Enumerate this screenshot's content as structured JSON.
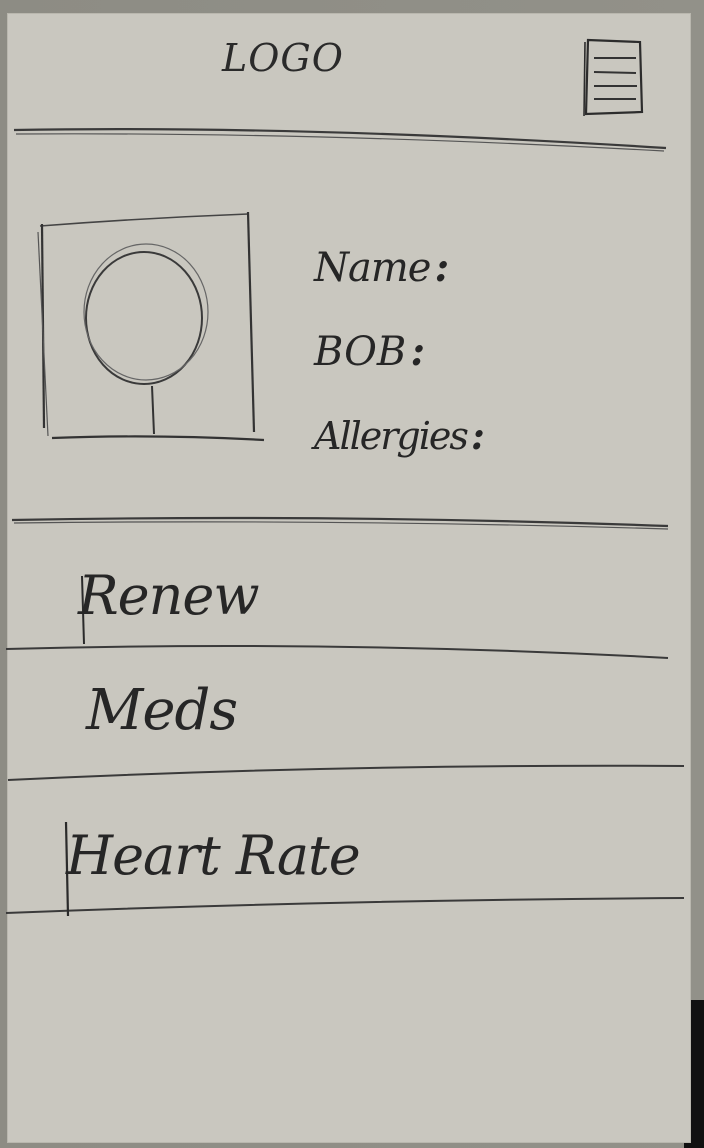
{
  "header": {
    "logo_text": "LOGO",
    "menu_icon": "hamburger-menu-icon"
  },
  "profile": {
    "avatar_icon": "user-avatar-placeholder-icon",
    "fields": [
      {
        "label": "Name",
        "suffix": ":"
      },
      {
        "label": "BOB",
        "suffix": ":"
      },
      {
        "label": "Allergies",
        "suffix": ":"
      }
    ]
  },
  "menu": {
    "items": [
      {
        "label": "Renew"
      },
      {
        "label": "Meds"
      },
      {
        "label": "Heart Rate"
      }
    ]
  },
  "colors": {
    "paper": "#c9c7bf",
    "pencil": "#2a2a2a",
    "background": "#8e8d85"
  }
}
